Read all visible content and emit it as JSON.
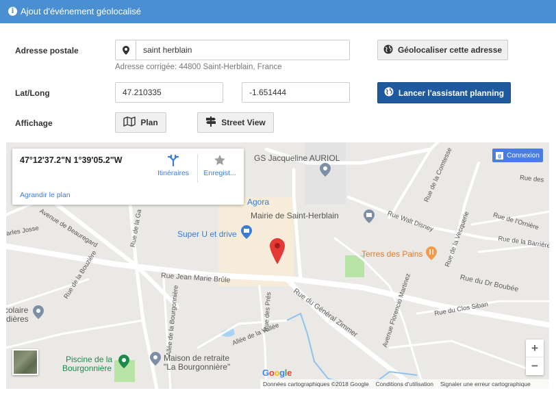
{
  "modal": {
    "title": "Ajout d'événement géolocalisé",
    "icon": "info-circle-icon"
  },
  "form": {
    "address_label": "Adresse postale",
    "address_value": "saint herblain",
    "address_icon": "map-marker-icon",
    "corrected_address": "Adresse corrigée: 44800 Saint-Herblain, France",
    "geolocate_button": "Géolocaliser cette adresse",
    "latlong_label": "Lat/Long",
    "lat_value": "47.210335",
    "long_value": "-1.651444",
    "planning_button": "Lancer l'assistant planning",
    "display_label": "Affichage",
    "plan_button": "Plan",
    "streetview_button": "Street View"
  },
  "map": {
    "info_card": {
      "coords": "47°12'37.2\"N 1°39'05.2\"W",
      "directions_label": "Itinéraires",
      "save_label": "Enregist...",
      "enlarge_link": "Agrandir le plan"
    },
    "connexion_label": "Connexion",
    "pois": {
      "gs": "GS Jacqueline AURIOL",
      "agora": "Agora",
      "mairie": "Mairie de Saint-Herblain",
      "superu": "Super U et drive",
      "terres": "Terres des Pains",
      "piscine_1": "Piscine de la",
      "piscine_2": "Bourgonnière",
      "maison_1": "Maison de retraite",
      "maison_2": "\"La Bourgonnière\"",
      "scolaire_1": "colaire",
      "scolaire_2": "dières"
    },
    "streets": {
      "jean_marie_brule": "Rue Jean Marie Brûle",
      "general_zimmer": "Rue du Général Zimmer",
      "dr_boubee": "Rue du Dr Boubée",
      "beauregard": "Avenue de Beauregard",
      "walt_disney": "Rue Walt Disney",
      "orniere": "Rue de l'Ornière",
      "barriere": "Rue de la Barrière de F",
      "vecquerie": "Rue de la Vecquerie",
      "comtesse": "Rue de la Comtesse",
      "rue_des": "Rue des",
      "clos_siban": "Rue du Clos Siban",
      "florencio": "Avenue Florencio Martinez",
      "allee_vallee": "Allée de la Vallée",
      "allee_bourgonniere": "Allée de la Bourgonnière",
      "rue_pres": "Rue des Prés",
      "rue_bourzie": "Rue de la Bouzière",
      "rue_de_la_ga": "Rue de la Ga",
      "rue_josse": "arles Josse"
    },
    "footer": {
      "data": "Données cartographiques ©2018 Google",
      "terms": "Conditions d'utilisation",
      "report": "Signaler une erreur cartographique"
    },
    "zoom_in": "+",
    "zoom_out": "−",
    "logo": [
      "G",
      "o",
      "o",
      "g",
      "l",
      "e"
    ],
    "colors": {
      "pin": "#e53935",
      "poi_blue": "#3a7bd5",
      "poi_orange": "#e07a2e",
      "poi_green": "#1d8a4c",
      "primary_button": "#1f5a9e",
      "header": "#4a8fd1"
    }
  }
}
